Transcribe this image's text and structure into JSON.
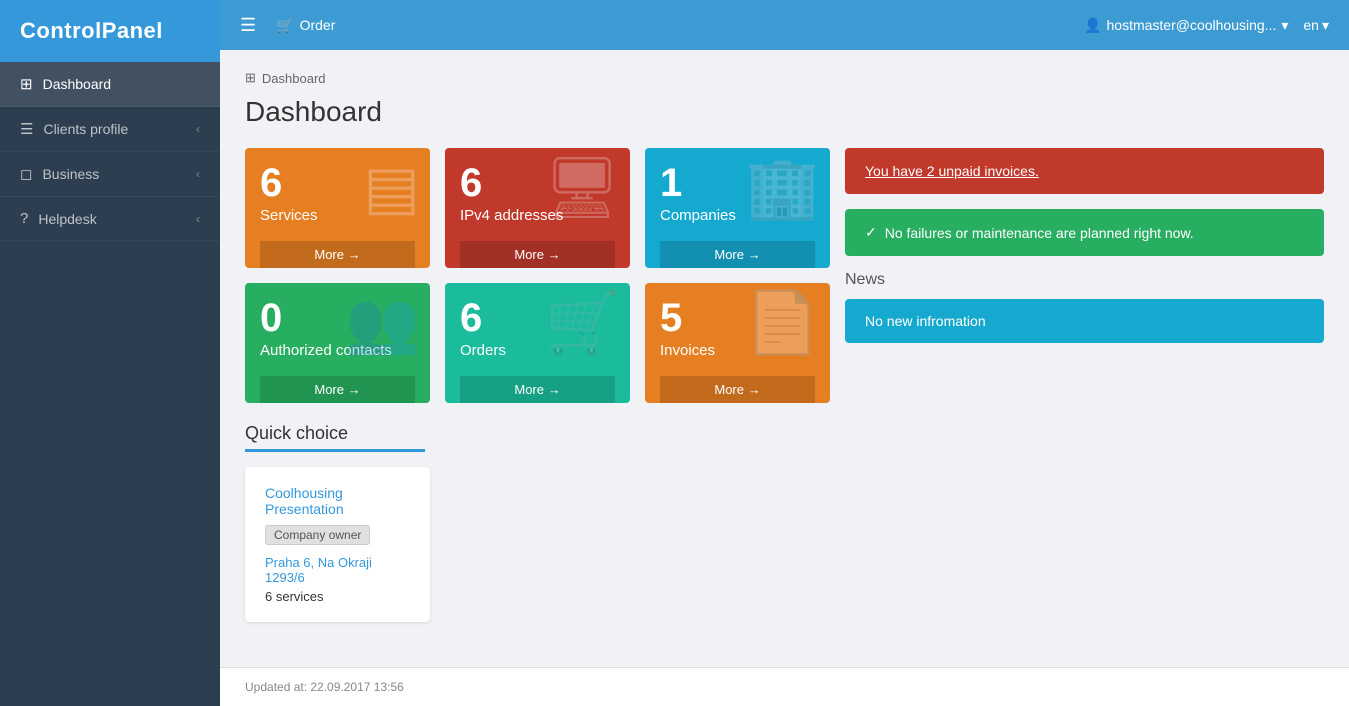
{
  "app": {
    "title": "ControlPanel"
  },
  "topbar": {
    "order_label": "Order",
    "user": "hostmaster@coolhousing...",
    "lang": "en"
  },
  "sidebar": {
    "items": [
      {
        "id": "dashboard",
        "label": "Dashboard",
        "icon": "⊞",
        "active": true,
        "hasChevron": false
      },
      {
        "id": "clients-profile",
        "label": "Clients profile",
        "icon": "☰",
        "active": false,
        "hasChevron": true
      },
      {
        "id": "business",
        "label": "Business",
        "icon": "◻",
        "active": false,
        "hasChevron": true
      },
      {
        "id": "helpdesk",
        "label": "Helpdesk",
        "icon": "?",
        "active": false,
        "hasChevron": true
      }
    ]
  },
  "breadcrumb": {
    "icon": "⊞",
    "label": "Dashboard"
  },
  "page": {
    "title": "Dashboard"
  },
  "stat_cards": [
    {
      "id": "services",
      "number": "6",
      "label": "Services",
      "more": "More",
      "color": "orange",
      "icon": "▤"
    },
    {
      "id": "ipv4",
      "number": "6",
      "label": "IPv4 addresses",
      "more": "More",
      "color": "red",
      "icon": "🖥"
    },
    {
      "id": "companies",
      "number": "1",
      "label": "Companies",
      "more": "More",
      "color": "cyan",
      "icon": "🏢"
    },
    {
      "id": "authorized-contacts",
      "number": "0",
      "label": "Authorized contacts",
      "more": "More",
      "color": "green",
      "icon": "👥"
    },
    {
      "id": "orders",
      "number": "6",
      "label": "Orders",
      "more": "More",
      "color": "teal",
      "icon": "🛒"
    },
    {
      "id": "invoices",
      "number": "5",
      "label": "Invoices",
      "more": "More",
      "color": "amber",
      "icon": "📄"
    }
  ],
  "alerts": {
    "unpaid": "You have 2 unpaid invoices.",
    "maintenance": "No failures or maintenance are planned right now."
  },
  "news": {
    "title": "News",
    "content": "No new infromation"
  },
  "quick_choice": {
    "title": "Quick choice",
    "company": {
      "name": "Coolhousing Presentation",
      "badge": "Company owner",
      "address": "Praha 6, Na Okraji 1293/6",
      "services": "6 services"
    }
  },
  "footer": {
    "updated": "Updated at: 22.09.2017 13:56"
  }
}
